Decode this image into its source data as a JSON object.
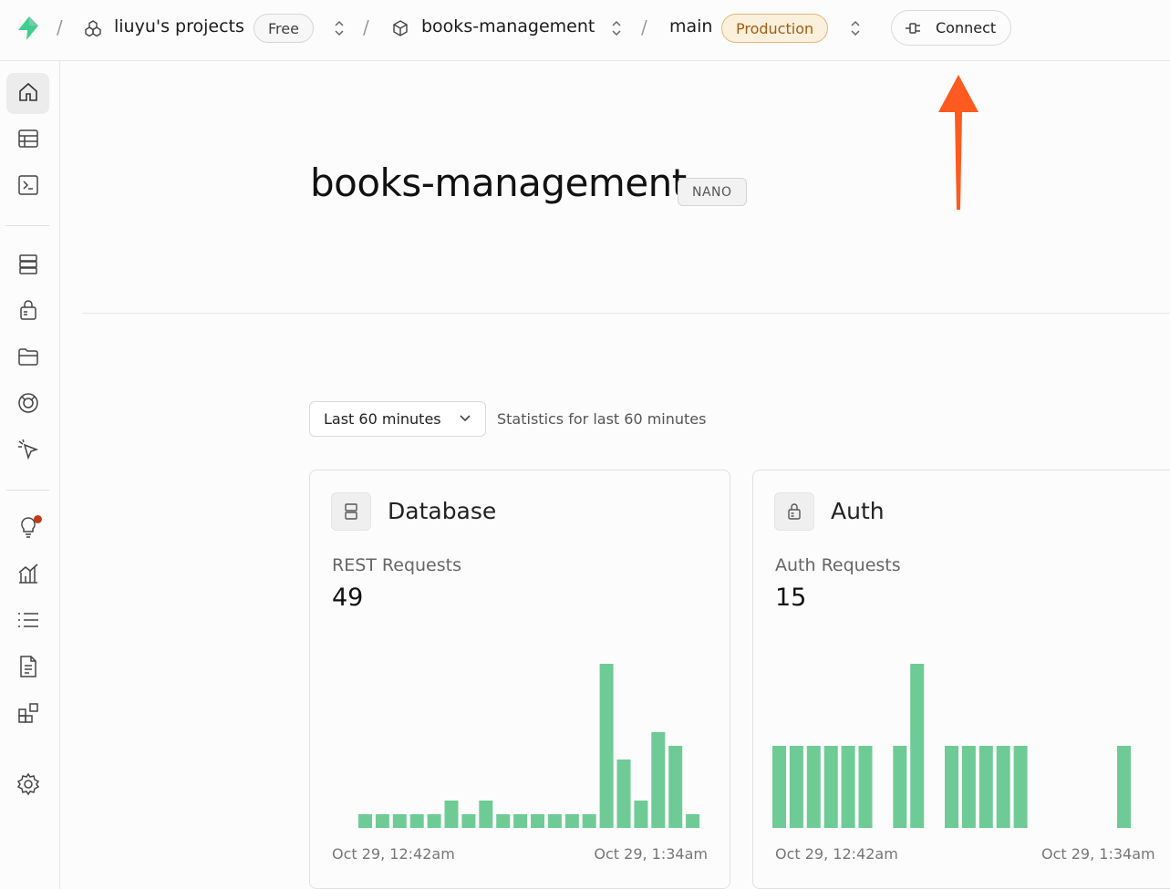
{
  "topbar": {
    "org_name": "liuyu's projects",
    "plan_badge": "Free",
    "project_name": "books-management",
    "branch_name": "main",
    "env_badge": "Production",
    "connect_label": "Connect",
    "separator": "/"
  },
  "sidebar": {
    "items": [
      {
        "name": "home",
        "icon": "home-icon",
        "active": true
      },
      {
        "name": "table-editor",
        "icon": "table-icon"
      },
      {
        "name": "sql-editor",
        "icon": "terminal-icon"
      },
      {
        "name": "database",
        "icon": "database-icon"
      },
      {
        "name": "authentication",
        "icon": "lock-icon"
      },
      {
        "name": "storage",
        "icon": "folder-icon"
      },
      {
        "name": "realtime",
        "icon": "realtime-icon"
      },
      {
        "name": "edge-functions",
        "icon": "cursor-icon"
      },
      {
        "name": "advisors",
        "icon": "lightbulb-icon",
        "notification": true
      },
      {
        "name": "reports",
        "icon": "chart-icon"
      },
      {
        "name": "logs",
        "icon": "list-icon"
      },
      {
        "name": "api-docs",
        "icon": "document-icon"
      },
      {
        "name": "integrations",
        "icon": "integrations-icon"
      },
      {
        "name": "settings",
        "icon": "gear-icon"
      }
    ]
  },
  "main": {
    "project_title": "books-management",
    "compute_badge": "NANO",
    "range_select_value": "Last 60 minutes",
    "range_note": "Statistics for last 60 minutes"
  },
  "cards": [
    {
      "title": "Database",
      "icon": "database-icon",
      "metric_label": "REST Requests",
      "metric_value": "49",
      "x_start": "Oct 29, 12:42am",
      "x_end": "Oct 29, 1:34am"
    },
    {
      "title": "Auth",
      "icon": "lock-icon",
      "metric_label": "Auth Requests",
      "metric_value": "15",
      "x_start": "Oct 29, 12:42am",
      "x_end": "Oct 29, 1:34am"
    }
  ],
  "colors": {
    "bar": "#6fcb95",
    "accent_arrow": "#ff5a1f",
    "production_badge_bg": "#fbf0dc"
  },
  "chart_data": [
    {
      "type": "bar",
      "title": "REST Requests",
      "values": [
        1,
        1,
        1,
        1,
        1,
        2,
        1,
        2,
        1,
        1,
        1,
        1,
        1,
        1,
        12,
        5,
        2,
        7,
        6,
        1
      ],
      "x_range": [
        "Oct 29, 12:42am",
        "Oct 29, 1:34am"
      ],
      "grid": false
    },
    {
      "type": "bar",
      "title": "Auth Requests",
      "values": [
        1,
        1,
        1,
        1,
        1,
        1,
        0,
        1,
        2,
        0,
        1,
        1,
        1,
        1,
        1,
        0,
        0,
        0,
        0,
        0,
        1
      ],
      "x_range": [
        "Oct 29, 12:42am",
        "Oct 29, 1:34am"
      ],
      "grid": false
    }
  ]
}
